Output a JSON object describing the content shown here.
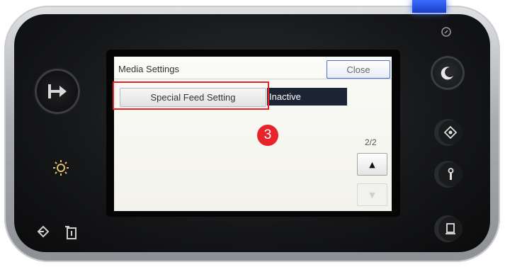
{
  "screen": {
    "title": "Media Settings",
    "close_label": "Close",
    "setting_label": "Special Feed Setting",
    "setting_value": "Inactive",
    "page_indicator": "2/2",
    "scroll_up_glyph": "▲",
    "scroll_down_glyph": "▼"
  },
  "annotation": {
    "step_number": "3",
    "highlight_color": "#e8232a"
  },
  "device": {
    "icons": [
      "home-icon",
      "brightness-icon",
      "login-icon",
      "data-in-icon",
      "power-icon",
      "sleep-icon",
      "settings-icon",
      "tool-icon",
      "document-icon"
    ],
    "led_color": "#3a6bff"
  }
}
